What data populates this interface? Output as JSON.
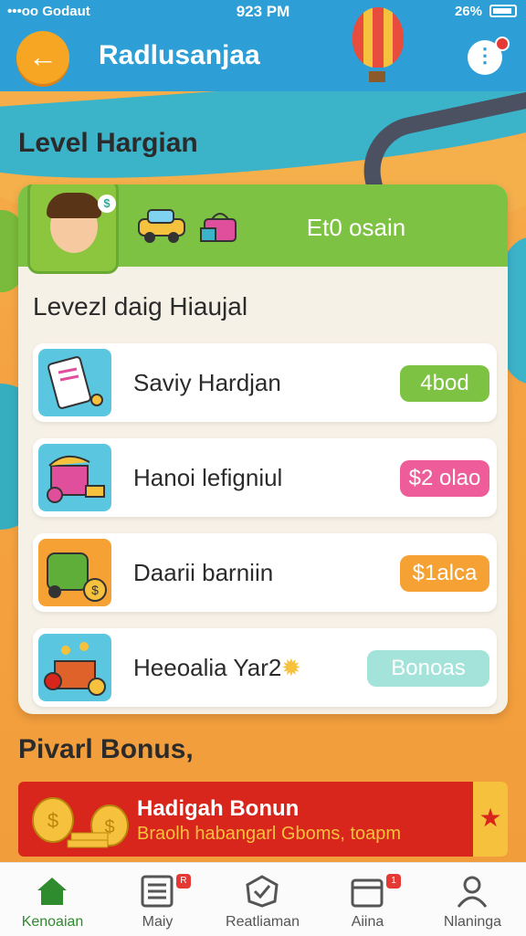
{
  "status_bar": {
    "carrier": "•••oo Godaut",
    "time": "923 PM",
    "battery": "26%"
  },
  "header": {
    "title": "Radlusanjaa"
  },
  "page": {
    "title": "Level Hargian",
    "subheading": "Levezl daig Hiaujal"
  },
  "banner": {
    "text": "Et0 osain"
  },
  "items": [
    {
      "label": "Saviy Hardjan",
      "badge": "4bod",
      "badge_color": "#7dc242"
    },
    {
      "label": "Hanoi lefigniul",
      "badge": "$2 olao",
      "badge_color": "#ee5d99"
    },
    {
      "label": "Daarii barniin",
      "badge": "$1alca",
      "badge_color": "#f5a134"
    },
    {
      "label": "Heeoalia Yar2",
      "badge": "Bonoas",
      "badge_color": "#a4e3d9"
    }
  ],
  "section": {
    "title": "Pivarl Bonus,"
  },
  "bonus": {
    "title": "Hadigah Bonun",
    "subtitle": "Braolh habangarl Gboms, toapm"
  },
  "nav": [
    {
      "label": "Kenoaian",
      "icon": "home-icon",
      "active": true
    },
    {
      "label": "Maiy",
      "icon": "list-icon",
      "badge": "R"
    },
    {
      "label": "Reatliaman",
      "icon": "badge-check-icon"
    },
    {
      "label": "Aiina",
      "icon": "calendar-icon",
      "badge": "1"
    },
    {
      "label": "Nlaninga",
      "icon": "profile-icon"
    }
  ]
}
